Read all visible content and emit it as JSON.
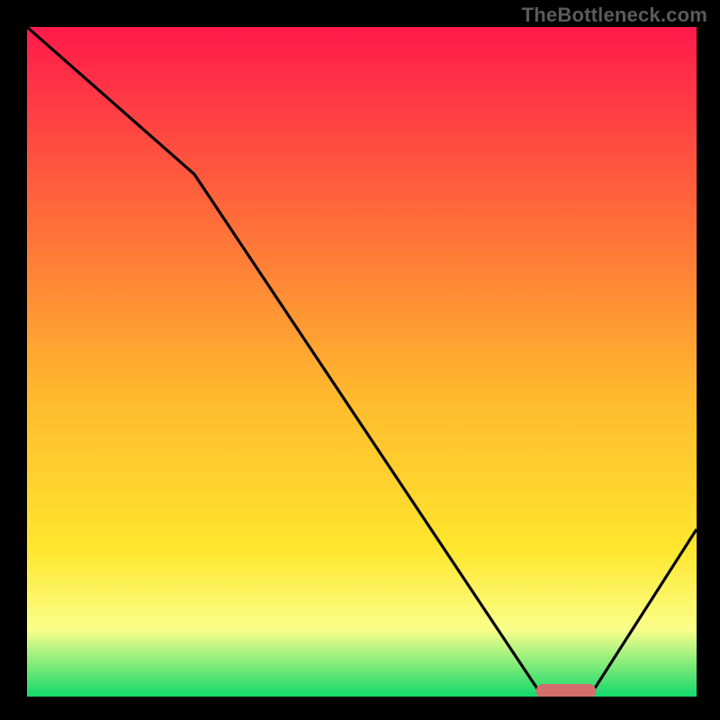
{
  "attribution": "TheBottleneck.com",
  "colors": {
    "gradient_top": "#ff1a4b",
    "gradient_mid1": "#ff6a3a",
    "gradient_mid2": "#ffb92e",
    "gradient_mid3": "#ffe62e",
    "gradient_mid4": "#faff8a",
    "gradient_bottom": "#11d96b",
    "frame": "#000000",
    "curve": "#000000",
    "marker": "#d36e6d"
  },
  "chart_data": {
    "type": "line",
    "title": "",
    "xlabel": "",
    "ylabel": "",
    "xlim": [
      0,
      100
    ],
    "ylim": [
      0,
      100
    ],
    "x": [
      0,
      25,
      77,
      84,
      100
    ],
    "values": [
      100,
      78,
      0,
      0,
      25
    ],
    "marker": {
      "x_start": 76,
      "x_end": 85,
      "y": 0
    },
    "annotations": []
  }
}
